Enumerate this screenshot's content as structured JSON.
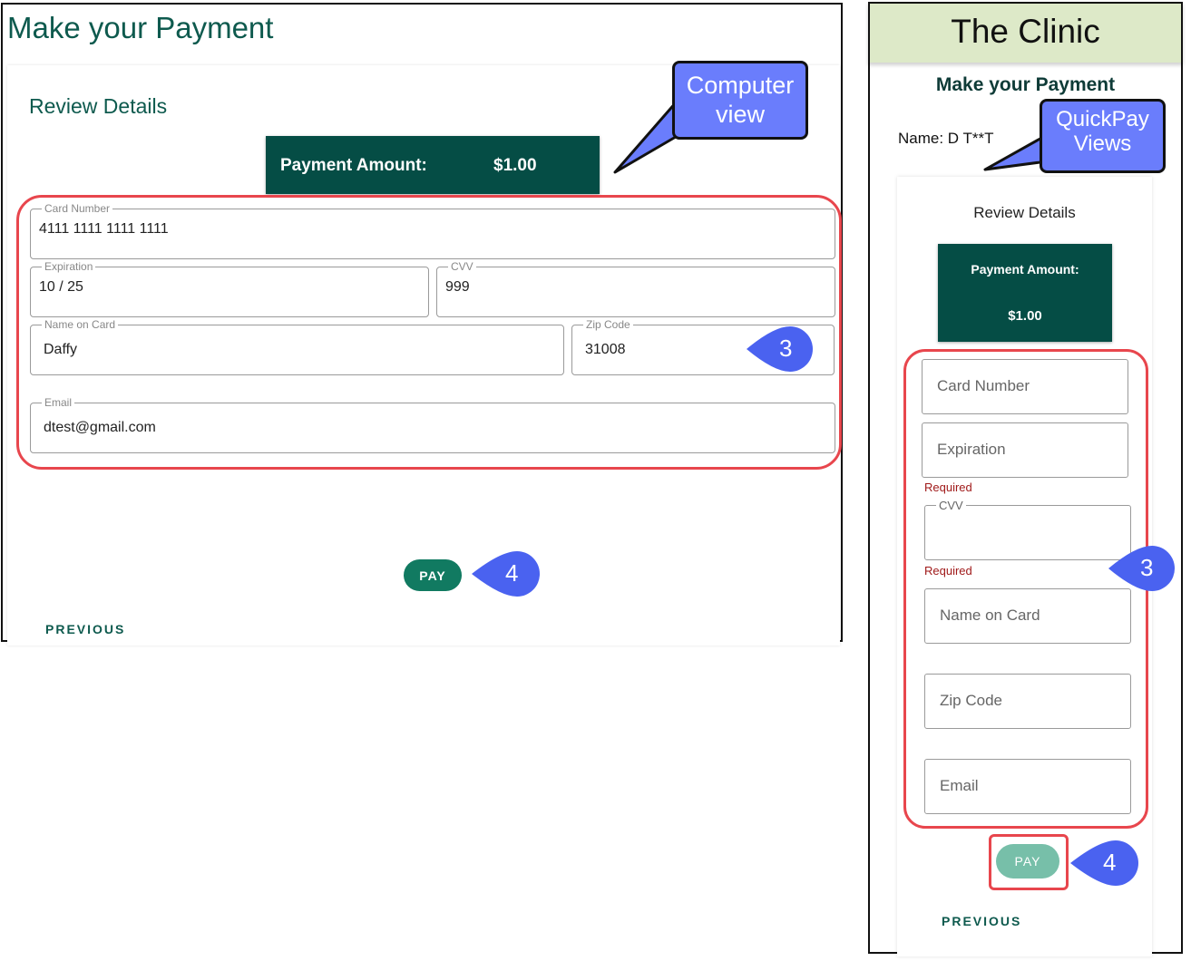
{
  "computer_view": {
    "page_title": "Make your Payment",
    "review_title": "Review Details",
    "amount_label": "Payment Amount:",
    "amount_value": "$1.00",
    "fields": {
      "card_number": {
        "label": "Card Number",
        "value": "4111 1111 1111 1111"
      },
      "expiration": {
        "label": "Expiration",
        "value": "10 / 25"
      },
      "cvv": {
        "label": "CVV",
        "value": "999"
      },
      "name_on_card": {
        "label": "Name on Card",
        "value": "Daffy"
      },
      "zip_code": {
        "label": "Zip Code",
        "value": "31008"
      },
      "email": {
        "label": "Email",
        "value": "dtest@gmail.com"
      }
    },
    "pay_label": "PAY",
    "previous_label": "PREVIOUS",
    "callout": {
      "line1": "Computer",
      "line2": "view"
    },
    "step_fields": "3",
    "step_pay": "4"
  },
  "quickpay_view": {
    "header_title": "The Clinic",
    "page_title": "Make your Payment",
    "name_line": "Name: D T**T",
    "review_title": "Review Details",
    "amount_label": "Payment Amount:",
    "amount_value": "$1.00",
    "fields": {
      "card_number": "Card Number",
      "expiration": "Expiration",
      "cvv_label": "CVV",
      "name_on_card": "Name on Card",
      "zip_code": "Zip Code",
      "email": "Email"
    },
    "required_text": "Required",
    "pay_label": "PAY",
    "previous_label": "PREVIOUS",
    "callout": {
      "line1": "QuickPay",
      "line2": "Views"
    },
    "step_fields": "3",
    "step_pay": "4"
  },
  "colors": {
    "brand_dark": "#054d45",
    "brand_text": "#0e5a4e",
    "pay_button": "#117a61",
    "pay_button_disabled": "#77bfa9",
    "highlight_red": "#e8464d",
    "callout_blue": "#6a7dfc",
    "marker_blue": "#4a62f0",
    "header_bg": "#dde9c8"
  }
}
